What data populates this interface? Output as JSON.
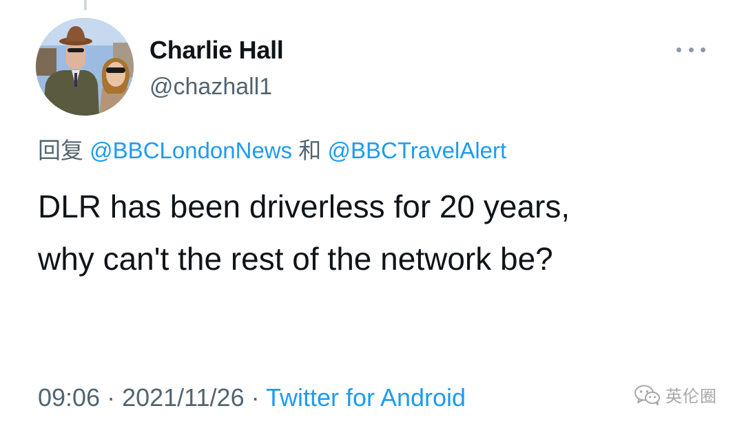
{
  "tweet": {
    "author": {
      "display_name": "Charlie Hall",
      "handle": "@chazhall1"
    },
    "reply": {
      "prefix": "回复",
      "mention_1": "@BBCLondonNews",
      "joiner": "和",
      "mention_2": "@BBCTravelAlert"
    },
    "text_line_1": "DLR has been driverless for 20 years,",
    "text_line_2": "why can't the rest of the network be?",
    "meta": {
      "time": "09:06",
      "separator_1": " · ",
      "date": "2021/11/26",
      "separator_2": " · ",
      "source": "Twitter for Android"
    }
  },
  "icons": {
    "more": "more-horizontal-icon",
    "watermark": "wechat-icon"
  },
  "watermark": {
    "label": "英伦圈"
  },
  "colors": {
    "link": "#1d9bf0",
    "secondary_text": "#536471",
    "primary_text": "#0f1419"
  }
}
